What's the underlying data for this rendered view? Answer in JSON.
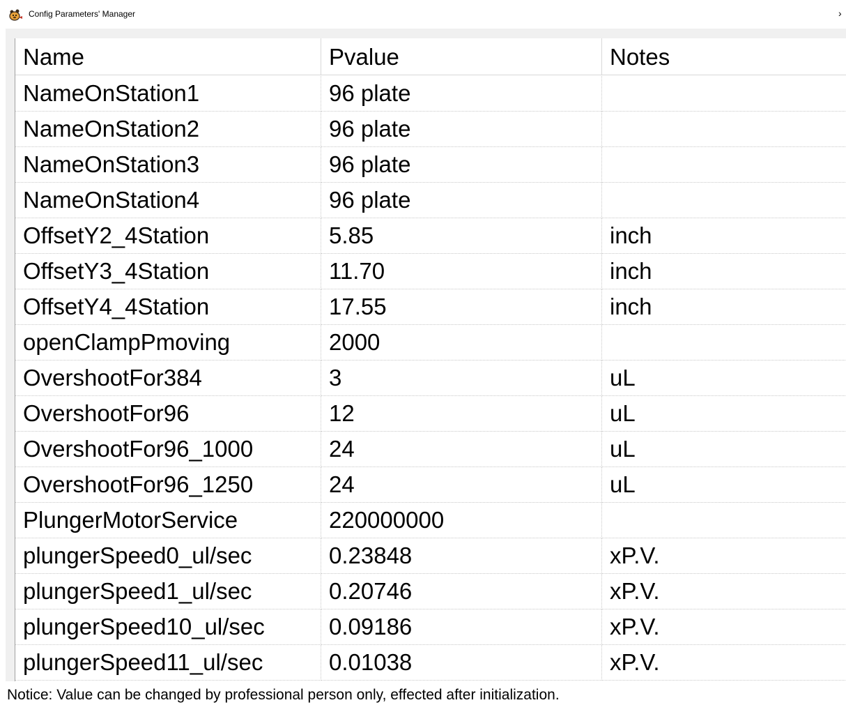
{
  "window": {
    "title": "Config Parameters' Manager",
    "icon": "gear-bear-app-icon",
    "close_glyph": "›"
  },
  "table": {
    "columns": [
      "Name",
      "Pvalue",
      "Notes"
    ],
    "rows": [
      {
        "name": "NameOnStation1",
        "value": "96 plate",
        "notes": ""
      },
      {
        "name": "NameOnStation2",
        "value": "96 plate",
        "notes": ""
      },
      {
        "name": "NameOnStation3",
        "value": "96 plate",
        "notes": ""
      },
      {
        "name": "NameOnStation4",
        "value": "96 plate",
        "notes": ""
      },
      {
        "name": "OffsetY2_4Station",
        "value": "5.85",
        "notes": "inch"
      },
      {
        "name": "OffsetY3_4Station",
        "value": "11.70",
        "notes": "inch"
      },
      {
        "name": "OffsetY4_4Station",
        "value": "17.55",
        "notes": "inch"
      },
      {
        "name": "openClampPmoving",
        "value": "2000",
        "notes": ""
      },
      {
        "name": "OvershootFor384",
        "value": "3",
        "notes": "uL"
      },
      {
        "name": "OvershootFor96",
        "value": "12",
        "notes": "uL"
      },
      {
        "name": "OvershootFor96_1000",
        "value": "24",
        "notes": "uL"
      },
      {
        "name": "OvershootFor96_1250",
        "value": "24",
        "notes": "uL"
      },
      {
        "name": "PlungerMotorService",
        "value": "220000000",
        "notes": ""
      },
      {
        "name": "plungerSpeed0_ul/sec",
        "value": "0.23848",
        "notes": "xP.V."
      },
      {
        "name": "plungerSpeed1_ul/sec",
        "value": "0.20746",
        "notes": "xP.V."
      },
      {
        "name": "plungerSpeed10_ul/sec",
        "value": "0.09186",
        "notes": "xP.V."
      },
      {
        "name": "plungerSpeed11_ul/sec",
        "value": "0.01038",
        "notes": "xP.V."
      }
    ]
  },
  "notice": "Notice: Value can be changed by professional person only, effected after initialization."
}
